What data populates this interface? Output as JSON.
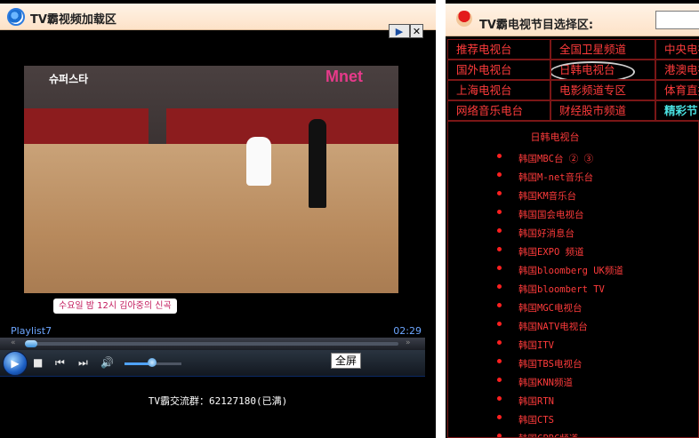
{
  "left_panel": {
    "title": "TV霸视频加载区",
    "ad_buttons": {
      "play": "▶",
      "close": "✕"
    },
    "video": {
      "logo_left": "슈퍼스타",
      "logo_right": "Mnet",
      "caption": "수요일 밤 12시 김아중의 신곡"
    },
    "player": {
      "playlist": "Playlist7",
      "time": "02:29",
      "seek_progress": 0.0,
      "volume": 0.45,
      "fullscreen_label": "全屏"
    },
    "group_text": "TV霸交流群：62127180(已满)"
  },
  "right_panel": {
    "title": "TV霸电视节目选择区:",
    "search_placeholder": "",
    "categories": [
      [
        "推荐电视台",
        "全国卫星频道",
        "中央电视台"
      ],
      [
        "国外电视台",
        "日韩电视台",
        "港澳电视台"
      ],
      [
        "上海电视台",
        "电影频道专区",
        "体育直播"
      ],
      [
        "网络音乐电台",
        "财经股市频道",
        "精彩节目"
      ]
    ],
    "list_title": "日韩电视台",
    "channels": [
      "韩国MBC台 ② ③",
      "韩国M-net音乐台",
      "韩国KM音乐台",
      "韩国国会电视台",
      "韩国好消息台",
      "韩国EXPO 频道",
      "韩国bloomberg UK频道",
      "韩国bloombert TV",
      "韩国MGC电视台",
      "韩国NATV电视台",
      "韩国ITV",
      "韩国TBS电视台",
      "韩国KNN频道",
      "韩国RTN",
      "韩国CTS",
      "韩国CPBC频道"
    ]
  },
  "colors": {
    "accent_red": "#ff3b3b",
    "highlight_cyan": "#49e0e0",
    "player_blue": "#1c5fc4"
  }
}
